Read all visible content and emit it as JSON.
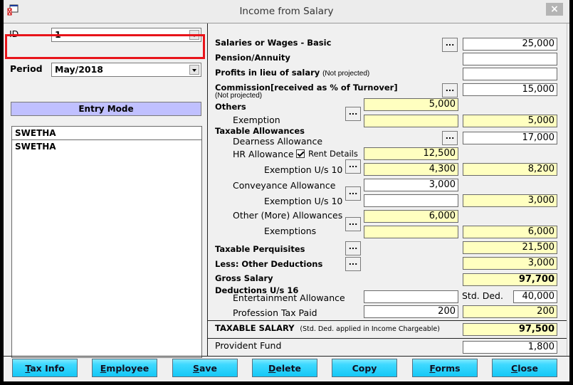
{
  "window": {
    "title": "Income from Salary",
    "close_label": "×"
  },
  "left": {
    "id_label": "ID",
    "id_value": "1",
    "period_label": "Period",
    "period_value": "May/2018",
    "entry_mode_label": "Entry Mode",
    "list_items": [
      "SWETHA",
      "SWETHA"
    ]
  },
  "income": {
    "basic": {
      "label": "Salaries or Wages - Basic",
      "value": "25,000"
    },
    "pension": {
      "label": "Pension/Annuity",
      "value": ""
    },
    "profits": {
      "label": "Profits in lieu of salary",
      "note": "(Not projected)",
      "value": ""
    },
    "commission": {
      "label": "Commission[received as % of Turnover]",
      "note": "(Not projected)",
      "value": "15,000"
    },
    "others": {
      "label": "Others",
      "value": "5,000"
    },
    "others_exemption": {
      "label": "Exemption",
      "value": "",
      "net": "5,000"
    },
    "taxable_allowances_label": "Taxable Allowances",
    "dearness": {
      "label": "Dearness Allowance",
      "value": "17,000"
    },
    "hra": {
      "label": "HR Allowance",
      "checkbox_label": "Rent Details",
      "checked": true,
      "value": "12,500"
    },
    "hra_exemption": {
      "label": "Exemption U/s 10",
      "value": "4,300",
      "net": "8,200"
    },
    "conveyance": {
      "label": "Conveyance Allowance",
      "value": "3,000"
    },
    "conveyance_exemption": {
      "label": "Exemption U/s 10",
      "value": "",
      "net": "3,000"
    },
    "other_allowances": {
      "label": "Other (More) Allowances",
      "value": "6,000"
    },
    "other_exemptions": {
      "label": "Exemptions",
      "value": "",
      "net": "6,000"
    },
    "perquisites": {
      "label": "Taxable Perquisites",
      "value": "21,500"
    },
    "other_deductions": {
      "label": "Less: Other Deductions",
      "value": "3,000"
    },
    "gross": {
      "label": "Gross Salary",
      "value": "97,700"
    },
    "deductions_label": "Deductions U/s 16",
    "entertainment": {
      "label": "Entertainment Allowance",
      "value": ""
    },
    "std_ded": {
      "label": "Std. Ded.",
      "value": "40,000"
    },
    "profession_tax": {
      "label": "Profession Tax Paid",
      "value": "200",
      "net": "200"
    },
    "taxable_salary": {
      "label": "TAXABLE SALARY",
      "note": "(Std. Ded. applied in Income Chargeable)",
      "value": "97,500"
    },
    "provident_fund": {
      "label": "Provident Fund",
      "value": "1,800"
    },
    "more_button_label": "..."
  },
  "buttons": [
    {
      "first": "T",
      "rest": "ax Info"
    },
    {
      "first": "E",
      "rest": "mployee"
    },
    {
      "first": "S",
      "rest": "ave"
    },
    {
      "first": "D",
      "rest": "elete"
    },
    {
      "first": "",
      "rest": "Copy"
    },
    {
      "first": "F",
      "rest": "orms"
    },
    {
      "first": "C",
      "rest": "lose"
    }
  ]
}
